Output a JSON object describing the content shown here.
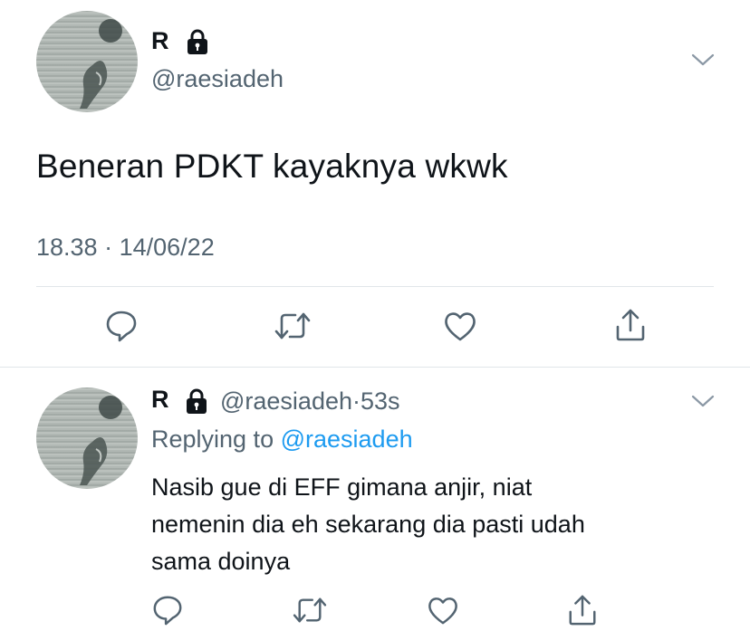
{
  "main_tweet": {
    "display_name": "R",
    "handle": "@raesiadeh",
    "text": "Beneran PDKT kayaknya wkwk",
    "time": "18.38",
    "separator": "·",
    "date": "14/06/22"
  },
  "reply_tweet": {
    "display_name": "R",
    "handle": "@raesiadeh",
    "separator": "·",
    "age": "53s",
    "replying_prefix": "Replying to",
    "replying_handle": "@raesiadeh",
    "text_lines": [
      "Nasib gue di EFF gimana anjir, niat",
      "nemenin dia eh sekarang dia pasti udah",
      "sama doinya"
    ]
  },
  "icons": {
    "protected": "lock-icon",
    "menu": "chevron-down-icon",
    "reply": "reply-icon",
    "retweet": "retweet-icon",
    "like": "heart-icon",
    "share": "share-icon"
  },
  "colors": {
    "text": "#0f1419",
    "secondary": "#536471",
    "link": "#1d9bf0",
    "divider": "#e1e6ea"
  }
}
